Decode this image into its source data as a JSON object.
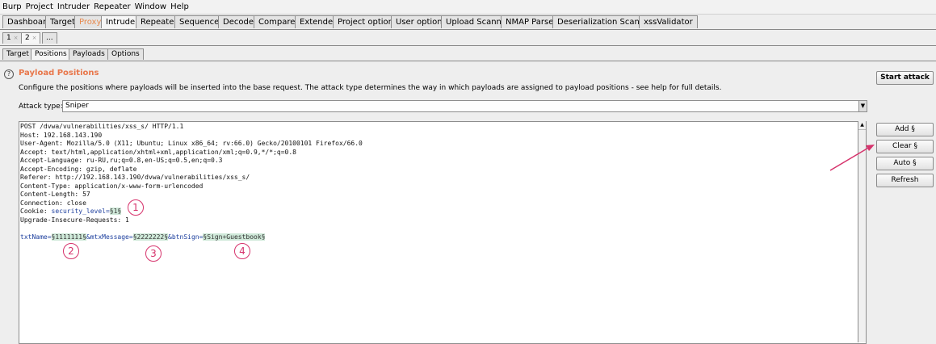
{
  "menu": [
    "Burp",
    "Project",
    "Intruder",
    "Repeater",
    "Window",
    "Help"
  ],
  "tabs": [
    "Dashboard",
    "Target",
    "Proxy",
    "Intruder",
    "Repeater",
    "Sequencer",
    "Decoder",
    "Comparer",
    "Extender",
    "Project options",
    "User options",
    "Upload Scanner",
    "NMAP Parser",
    "Deserialization Scanner",
    "xssValidator"
  ],
  "sub_tabs": [
    "1",
    "2",
    "..."
  ],
  "sub_tab_close": "×",
  "inner_tabs": [
    "Target",
    "Positions",
    "Payloads",
    "Options"
  ],
  "help_glyph": "?",
  "section_title": "Payload Positions",
  "description": "Configure the positions where payloads will be inserted into the base request. The attack type determines the way in which payloads are assigned to payload positions - see help for full details.",
  "attack_type_label": "Attack type:",
  "attack_type_value": "Sniper",
  "dropdown_arrow": "▼",
  "scroll_up": "▲",
  "request": {
    "lines": [
      "POST /dvwa/vulnerabilities/xss_s/ HTTP/1.1",
      "Host: 192.168.143.190",
      "User-Agent: Mozilla/5.0 (X11; Ubuntu; Linux x86_64; rv:66.0) Gecko/20100101 Firefox/66.0",
      "Accept: text/html,application/xhtml+xml,application/xml;q=0.9,*/*;q=0.8",
      "Accept-Language: ru-RU,ru;q=0.8,en-US;q=0.5,en;q=0.3",
      "Accept-Encoding: gzip, deflate",
      "Referer: http://192.168.143.190/dvwa/vulnerabilities/xss_s/",
      "Content-Type: application/x-www-form-urlencoded",
      "Content-Length: 57",
      "Connection: close"
    ],
    "cookie_prefix": "Cookie: ",
    "cookie_name": "security_level=",
    "cookie_payload": "§1§",
    "upgrade_line": "Upgrade-Insecure-Requests: 1",
    "body_key1": "txtName=",
    "body_payload1": "§1111111§",
    "body_key2": "&mtxMessage=",
    "body_payload2": "§2222222§",
    "body_key3": "&btnSign=",
    "body_payload3": "§Sign+Guestbook§"
  },
  "buttons": {
    "start_attack": "Start attack",
    "add": "Add §",
    "clear": "Clear §",
    "auto": "Auto §",
    "refresh": "Refresh"
  },
  "annotations": [
    "1",
    "2",
    "3",
    "4"
  ],
  "colors": {
    "accent": "#e8764a",
    "annotation": "#d6336c",
    "payload_highlight": "#cfe9d9"
  }
}
